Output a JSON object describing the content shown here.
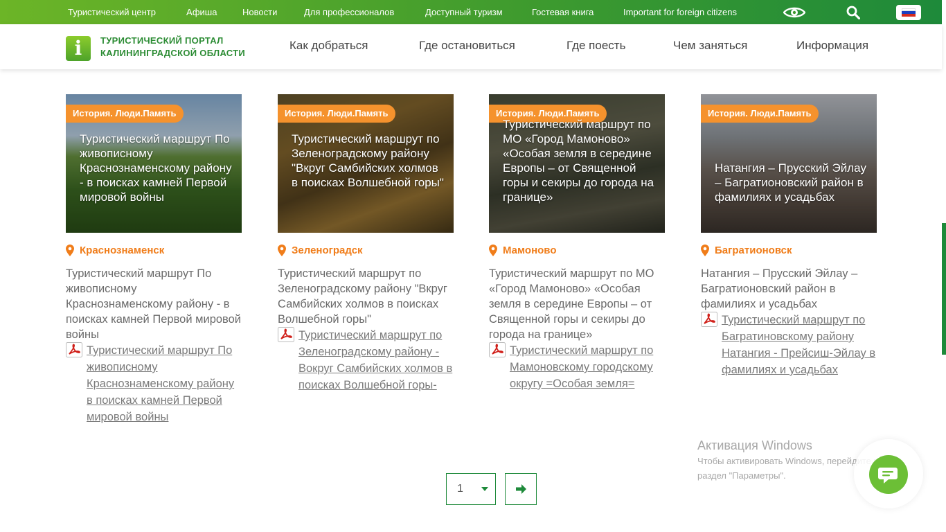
{
  "topbar": {
    "links": [
      "Туристический центр",
      "Афиша",
      "Новости",
      "Для профессионалов",
      "Доступный туризм",
      "Гостевая книга",
      "Important for foreign citizens"
    ],
    "icons": [
      "eye-icon",
      "search-icon",
      "russian-flag-icon"
    ]
  },
  "header": {
    "logo_letter": "i",
    "logo_line1": "ТУРИСТИЧЕСКИЙ ПОРТАЛ",
    "logo_line2": "КАЛИНИНГРАДСКОЙ ОБЛАСТИ",
    "nav": [
      "Как добраться",
      "Где остановиться",
      "Где поесть",
      "Чем заняться",
      "Информация"
    ]
  },
  "cards": [
    {
      "badge": "История. Люди.Память",
      "thumb_title": "Туристический маршрут По живописному Краснознаменскому району - в поисках камней Первой мировой войны",
      "location": "Краснознаменск",
      "description": "Туристический маршрут По живописному Краснознаменскому району - в поисках камней Первой мировой войны",
      "pdf_link": "Туристический маршрут По живописному Краснознаменскому району в поисках камней Первой мировой войны"
    },
    {
      "badge": "История. Люди.Память",
      "thumb_title": "Туристический маршрут по Зеленоградскому району \"Вкруг Самбийских холмов в поисках Волшебной горы\"",
      "location": "Зеленоградск",
      "description": "Туристический маршрут по Зеленоградскому району \"Вкруг Самбийских холмов в поисках Волшебной горы\"",
      "pdf_link": "Туристический маршрут по Зеленоградскому району - Вокруг Самбийских холмов в поисках Волшебной горы-"
    },
    {
      "badge": "История. Люди.Память",
      "thumb_title": "Туристический маршрут по МО «Город Мамоново» «Особая земля в середине Европы – от Священной горы и секиры до города на границе»",
      "location": "Мамоново",
      "description": "Туристический маршрут по МО «Город Мамоново» «Особая земля в середине Европы – от Священной горы и секиры до города на границе»",
      "pdf_link": "Туристический маршрут по Мамоновскому городскому округу =Особая земля="
    },
    {
      "badge": "История. Люди.Память",
      "thumb_title": "Натангия – Прусский Эйлау – Багратионовский район в фамилиях и усадьбах",
      "location": "Багратионовск",
      "description": "Натангия – Прусский Эйлау – Багратионовский район в фамилиях и усадьбах",
      "pdf_link": "Туристический маршрут по Багратиновскому району Натангия - Прейсиш-Эйлау в фамилиях и усадьбах"
    }
  ],
  "pagination": {
    "current_page": "1"
  },
  "watermark": {
    "title": "Активация Windows",
    "line1": "Чтобы активировать Windows, перейдите в",
    "line2": "раздел \"Параметры\"."
  },
  "colors": {
    "brand_green": "#1e8a3a",
    "accent_orange": "#f5922d",
    "location_orange": "#f07d1a"
  }
}
